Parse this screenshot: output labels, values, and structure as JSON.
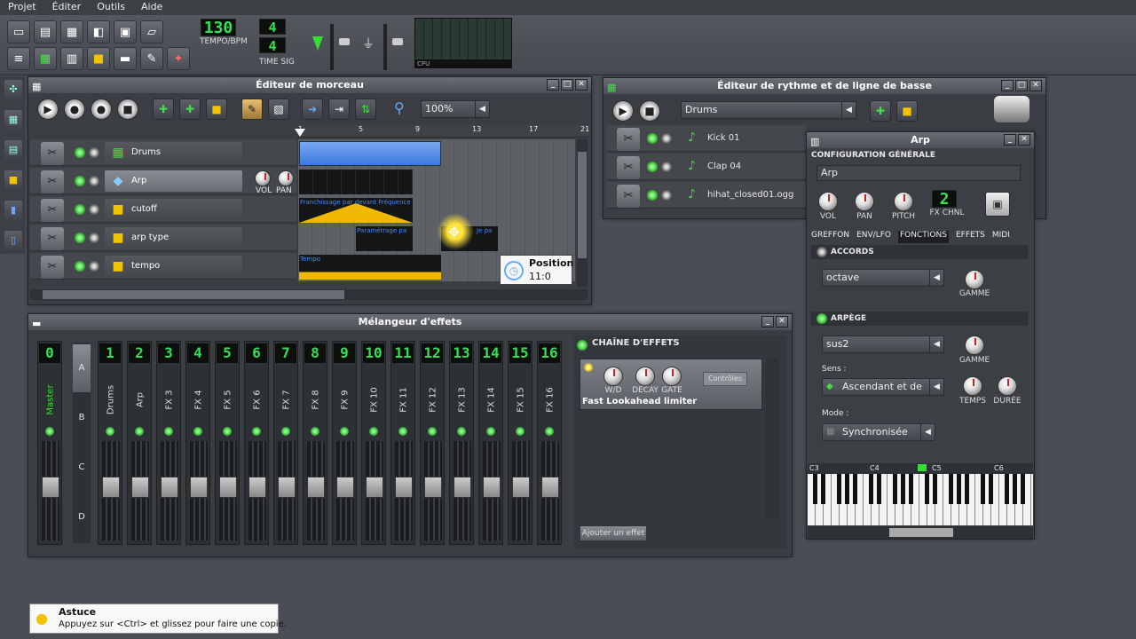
{
  "menu": [
    "Projet",
    "Éditer",
    "Outils",
    "Aide"
  ],
  "toolbar": {
    "tempo_value": "130",
    "tempo_label": "TEMPO/BPM",
    "timesig_top": "4",
    "timesig_bottom": "4",
    "timesig_label": "TIME SIG",
    "cpu_label": "CPU"
  },
  "song_editor": {
    "title": "Éditeur de morceau",
    "zoom": "100%",
    "ruler": [
      "1",
      "5",
      "9",
      "13",
      "17",
      "21"
    ],
    "tracks": [
      {
        "name": "Drums"
      },
      {
        "name": "Arp"
      },
      {
        "name": "cutoff"
      },
      {
        "name": "arp type"
      },
      {
        "name": "tempo"
      }
    ],
    "vol_label": "VOL",
    "pan_label": "PAN",
    "clips": {
      "cutoff": "Franchissage par devant Fréquence",
      "arptype1": "Paramétrage pa",
      "arptype2": "Je pa",
      "tempo": "Tempo"
    },
    "position_label": "Position",
    "position_value": "11:0"
  },
  "beat_editor": {
    "title": "Éditeur de rythme et de ligne de basse",
    "selected": "Drums",
    "tracks": [
      {
        "name": "Kick 01"
      },
      {
        "name": "Clap 04"
      },
      {
        "name": "hihat_closed01.ogg"
      }
    ]
  },
  "mixer": {
    "title": "Mélangeur d'effets",
    "banks": [
      "A",
      "B",
      "C",
      "D"
    ],
    "channels": [
      {
        "num": "0",
        "name": "Master"
      },
      {
        "num": "1",
        "name": "Drums"
      },
      {
        "num": "2",
        "name": "Arp"
      },
      {
        "num": "3",
        "name": "FX 3"
      },
      {
        "num": "4",
        "name": "FX 4"
      },
      {
        "num": "5",
        "name": "FX 5"
      },
      {
        "num": "6",
        "name": "FX 6"
      },
      {
        "num": "7",
        "name": "FX 7"
      },
      {
        "num": "8",
        "name": "FX 8"
      },
      {
        "num": "9",
        "name": "FX 9"
      },
      {
        "num": "10",
        "name": "FX 10"
      },
      {
        "num": "11",
        "name": "FX 11"
      },
      {
        "num": "12",
        "name": "FX 12"
      },
      {
        "num": "13",
        "name": "FX 13"
      },
      {
        "num": "14",
        "name": "FX 14"
      },
      {
        "num": "15",
        "name": "FX 15"
      },
      {
        "num": "16",
        "name": "FX 16"
      }
    ],
    "fx_chain_label": "CHAÎNE D'EFFETS",
    "effect_name": "Fast Lookahead limiter",
    "knobs": [
      "W/D",
      "DECAY",
      "GATE"
    ],
    "controls_button": "Contrôles",
    "add_effect_button": "Ajouter un effet"
  },
  "arp": {
    "title": "Arp",
    "general_label": "CONFIGURATION GÉNÉRALE",
    "instrument_name": "Arp",
    "knobs": [
      "VOL",
      "PAN",
      "PITCH"
    ],
    "fx_chnl_value": "2",
    "fx_chnl_label": "FX CHNL",
    "tabs": [
      "GREFFON",
      "ENV/LFO",
      "FONCTIONS",
      "EFFETS",
      "MIDI"
    ],
    "chords_label": "ACCORDS",
    "chord_value": "octave",
    "gamme_label": "GAMME",
    "arpeggio_label": "ARPÈGE",
    "arp_value": "sus2",
    "sens_label": "Sens :",
    "sens_value": "Ascendant et de",
    "temps_label": "TEMPS",
    "duree_label": "DURÉE",
    "mode_label": "Mode :",
    "mode_value": "Synchronisée",
    "piano_labels": [
      "C3",
      "C4",
      "C5",
      "C6"
    ]
  },
  "tip": {
    "title": "Astuce",
    "text": "Appuyez sur <Ctrl> et glissez pour faire une copie."
  }
}
